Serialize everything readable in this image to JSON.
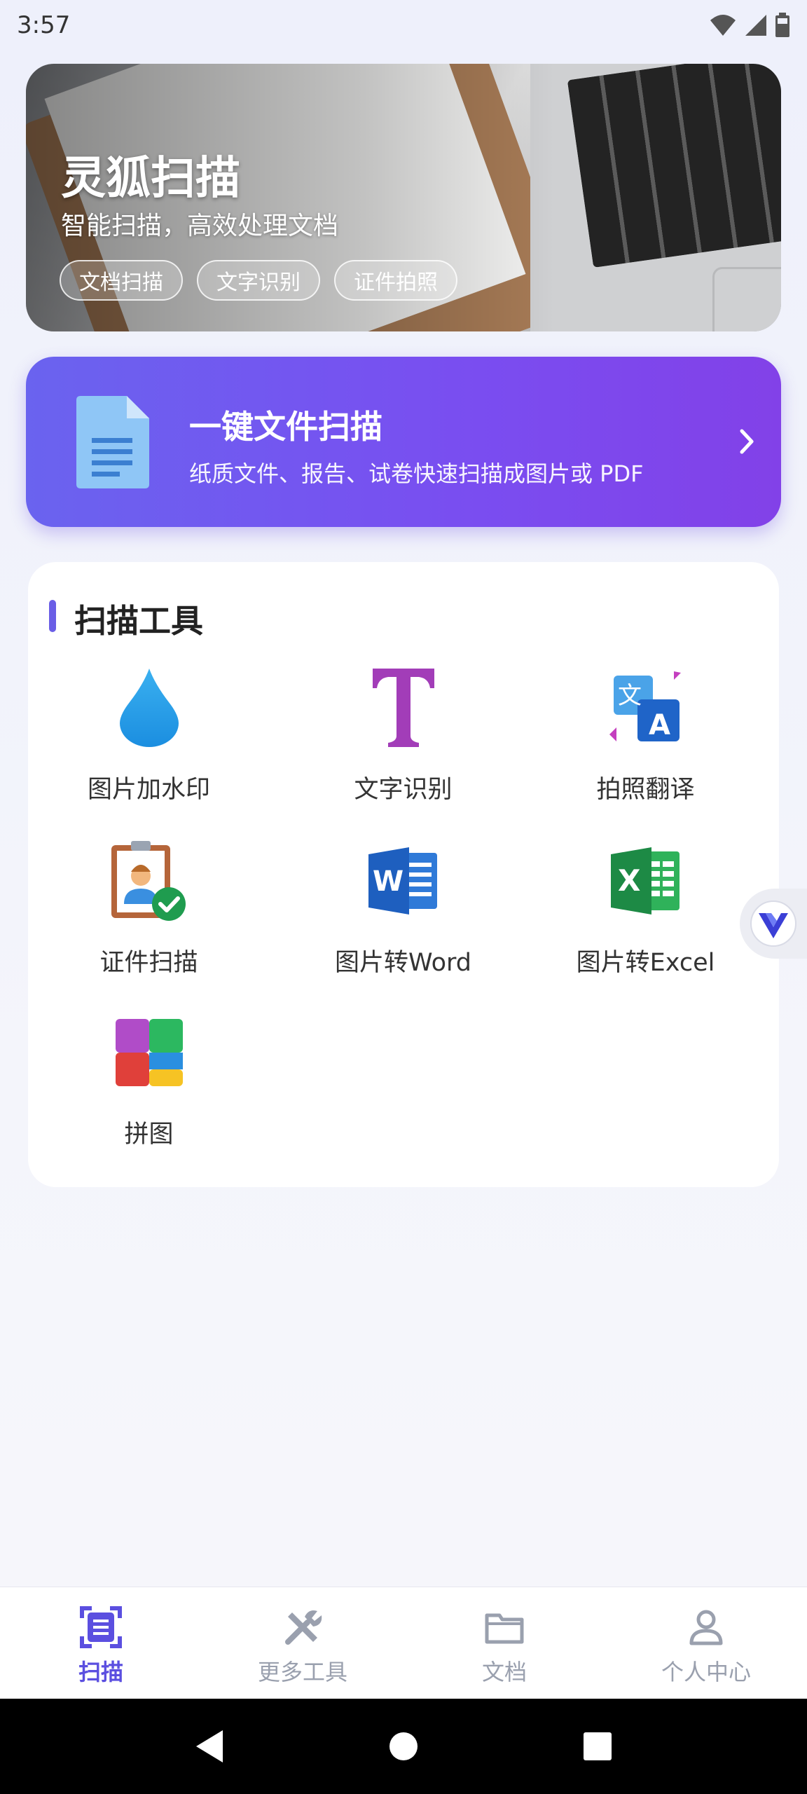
{
  "status": {
    "time": "3:57"
  },
  "banner": {
    "title": "灵狐扫描",
    "subtitle": "智能扫描，高效处理文档",
    "tags": [
      "文档扫描",
      "文字识别",
      "证件拍照"
    ]
  },
  "scan_card": {
    "title": "一键文件扫描",
    "description": "纸质文件、报告、试卷快速扫描成图片或 PDF"
  },
  "tools": {
    "title": "扫描工具",
    "items": [
      {
        "label": "图片加水印",
        "icon": "water-drop-icon"
      },
      {
        "label": "文字识别",
        "icon": "text-t-icon"
      },
      {
        "label": "拍照翻译",
        "icon": "translate-icon"
      },
      {
        "label": "证件扫描",
        "icon": "id-card-check-icon"
      },
      {
        "label": "图片转Word",
        "icon": "word-icon"
      },
      {
        "label": "图片转Excel",
        "icon": "excel-icon"
      },
      {
        "label": "拼图",
        "icon": "collage-icon"
      }
    ]
  },
  "tabbar": {
    "items": [
      {
        "label": "扫描",
        "icon": "scan-icon",
        "active": true
      },
      {
        "label": "更多工具",
        "icon": "tools-icon",
        "active": false
      },
      {
        "label": "文档",
        "icon": "folder-icon",
        "active": false
      },
      {
        "label": "个人中心",
        "icon": "person-icon",
        "active": false
      }
    ]
  },
  "colors": {
    "accent": "#5b4fe0",
    "scan_card_start": "#6a63ef",
    "scan_card_end": "#8241e8",
    "word_blue": "#1e5fbf",
    "excel_green": "#1d8a45"
  }
}
